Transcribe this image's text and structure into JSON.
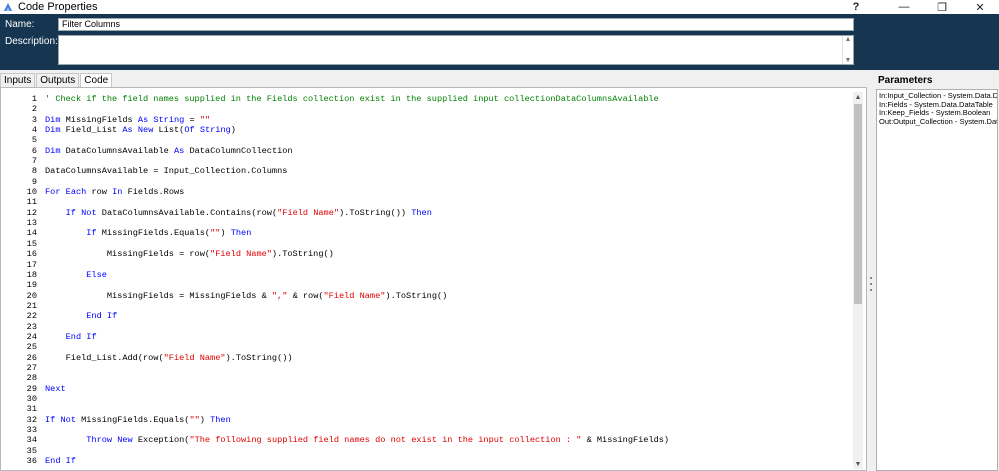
{
  "window": {
    "title": "Code Properties",
    "help_label": "?",
    "minimize_label": "—",
    "maximize_label": "❐",
    "close_label": "✕"
  },
  "header": {
    "name_label": "Name:",
    "name_value": "Filter Columns",
    "description_label": "Description:",
    "description_value": ""
  },
  "tabs": [
    {
      "label": "Inputs",
      "active": false
    },
    {
      "label": "Outputs",
      "active": false
    },
    {
      "label": "Code",
      "active": true
    }
  ],
  "code": {
    "line_numbers": [
      "1",
      "2",
      "3",
      "4",
      "5",
      "6",
      "7",
      "8",
      "9",
      "10",
      "11",
      "12",
      "13",
      "14",
      "15",
      "16",
      "17",
      "18",
      "19",
      "20",
      "21",
      "22",
      "23",
      "24",
      "25",
      "26",
      "27",
      "28",
      "29",
      "30",
      "31",
      "32",
      "33",
      "34",
      "35",
      "36"
    ],
    "lines": [
      [
        {
          "t": "' Check if the field names supplied in the Fields collection exist in the supplied input collectionDataColumnsAvailable",
          "c": "cm"
        }
      ],
      [],
      [
        {
          "t": "Dim",
          "c": "kw"
        },
        {
          "t": " MissingFields "
        },
        {
          "t": "As",
          "c": "kw"
        },
        {
          "t": " "
        },
        {
          "t": "String",
          "c": "kw"
        },
        {
          "t": " = "
        },
        {
          "t": "\"\"",
          "c": "str"
        }
      ],
      [
        {
          "t": "Dim",
          "c": "kw"
        },
        {
          "t": " Field_List "
        },
        {
          "t": "As",
          "c": "kw"
        },
        {
          "t": " "
        },
        {
          "t": "New",
          "c": "kw"
        },
        {
          "t": " List("
        },
        {
          "t": "Of",
          "c": "kw"
        },
        {
          "t": " "
        },
        {
          "t": "String",
          "c": "kw"
        },
        {
          "t": ")"
        }
      ],
      [],
      [
        {
          "t": "Dim",
          "c": "kw"
        },
        {
          "t": " DataColumnsAvailable "
        },
        {
          "t": "As",
          "c": "kw"
        },
        {
          "t": " DataColumnCollection"
        }
      ],
      [],
      [
        {
          "t": "DataColumnsAvailable = Input_Collection.Columns"
        }
      ],
      [],
      [
        {
          "t": "For",
          "c": "kw"
        },
        {
          "t": " "
        },
        {
          "t": "Each",
          "c": "kw"
        },
        {
          "t": " row "
        },
        {
          "t": "In",
          "c": "kw"
        },
        {
          "t": " Fields.Rows"
        }
      ],
      [],
      [
        {
          "t": "    "
        },
        {
          "t": "If",
          "c": "kw"
        },
        {
          "t": " "
        },
        {
          "t": "Not",
          "c": "kw"
        },
        {
          "t": " DataColumnsAvailable.Contains(row("
        },
        {
          "t": "\"Field Name\"",
          "c": "str"
        },
        {
          "t": ").ToString()) "
        },
        {
          "t": "Then",
          "c": "kw"
        }
      ],
      [],
      [
        {
          "t": "        "
        },
        {
          "t": "If",
          "c": "kw"
        },
        {
          "t": " MissingFields.Equals("
        },
        {
          "t": "\"\"",
          "c": "str"
        },
        {
          "t": ") "
        },
        {
          "t": "Then",
          "c": "kw"
        }
      ],
      [],
      [
        {
          "t": "            MissingFields = row("
        },
        {
          "t": "\"Field Name\"",
          "c": "str"
        },
        {
          "t": ").ToString()"
        }
      ],
      [],
      [
        {
          "t": "        "
        },
        {
          "t": "Else",
          "c": "kw"
        }
      ],
      [],
      [
        {
          "t": "            MissingFields = MissingFields & "
        },
        {
          "t": "\",\"",
          "c": "str"
        },
        {
          "t": " & row("
        },
        {
          "t": "\"Field Name\"",
          "c": "str"
        },
        {
          "t": ").ToString()"
        }
      ],
      [],
      [
        {
          "t": "        "
        },
        {
          "t": "End",
          "c": "kw"
        },
        {
          "t": " "
        },
        {
          "t": "If",
          "c": "kw"
        }
      ],
      [],
      [
        {
          "t": "    "
        },
        {
          "t": "End",
          "c": "kw"
        },
        {
          "t": " "
        },
        {
          "t": "If",
          "c": "kw"
        }
      ],
      [],
      [
        {
          "t": "    Field_List.Add(row("
        },
        {
          "t": "\"Field Name\"",
          "c": "str"
        },
        {
          "t": ").ToString())"
        }
      ],
      [],
      [],
      [
        {
          "t": "Next",
          "c": "kw"
        }
      ],
      [],
      [],
      [
        {
          "t": "If",
          "c": "kw"
        },
        {
          "t": " "
        },
        {
          "t": "Not",
          "c": "kw"
        },
        {
          "t": " MissingFields.Equals("
        },
        {
          "t": "\"\"",
          "c": "str"
        },
        {
          "t": ") "
        },
        {
          "t": "Then",
          "c": "kw"
        }
      ],
      [],
      [
        {
          "t": "        "
        },
        {
          "t": "Throw",
          "c": "kw"
        },
        {
          "t": " "
        },
        {
          "t": "New",
          "c": "kw"
        },
        {
          "t": " Exception("
        },
        {
          "t": "\"The following supplied field names do not exist in the input collection : \"",
          "c": "str"
        },
        {
          "t": " & MissingFields)"
        }
      ],
      [],
      [
        {
          "t": "End",
          "c": "kw"
        },
        {
          "t": " "
        },
        {
          "t": "If",
          "c": "kw"
        }
      ]
    ]
  },
  "parameters": {
    "title": "Parameters",
    "items": [
      "In:Input_Collection - System.Data.DataTable",
      "In:Fields - System.Data.DataTable",
      "In:Keep_Fields - System.Boolean",
      "Out:Output_Collection - System.Data.DataTable"
    ]
  },
  "colors": {
    "header_bg": "#163551",
    "keyword": "#0000ff",
    "string": "#e00000",
    "comment": "#008000"
  }
}
